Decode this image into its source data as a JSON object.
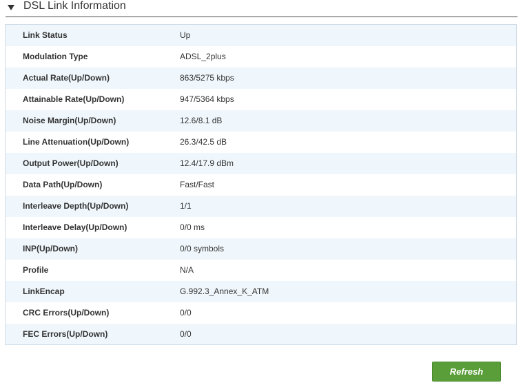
{
  "section": {
    "title": "DSL Link Information",
    "toggle_icon": "collapse-triangle-icon"
  },
  "rows": [
    {
      "label": "Link Status",
      "value": "Up"
    },
    {
      "label": "Modulation Type",
      "value": "ADSL_2plus"
    },
    {
      "label": "Actual Rate(Up/Down)",
      "value": "863/5275 kbps"
    },
    {
      "label": "Attainable Rate(Up/Down)",
      "value": "947/5364 kbps"
    },
    {
      "label": "Noise Margin(Up/Down)",
      "value": "12.6/8.1 dB"
    },
    {
      "label": "Line Attenuation(Up/Down)",
      "value": "26.3/42.5 dB"
    },
    {
      "label": "Output Power(Up/Down)",
      "value": "12.4/17.9 dBm"
    },
    {
      "label": "Data Path(Up/Down)",
      "value": "Fast/Fast"
    },
    {
      "label": "Interleave Depth(Up/Down)",
      "value": "1/1"
    },
    {
      "label": "Interleave Delay(Up/Down)",
      "value": "0/0 ms"
    },
    {
      "label": "INP(Up/Down)",
      "value": "0/0 symbols"
    },
    {
      "label": "Profile",
      "value": "N/A"
    },
    {
      "label": "LinkEncap",
      "value": "G.992.3_Annex_K_ATM"
    },
    {
      "label": "CRC Errors(Up/Down)",
      "value": "0/0"
    },
    {
      "label": "FEC Errors(Up/Down)",
      "value": "0/0"
    }
  ],
  "actions": {
    "refresh_label": "Refresh"
  },
  "colors": {
    "row_alt": "#f0f7fc",
    "border": "#cfdbe6",
    "button": "#5a9e3a"
  }
}
